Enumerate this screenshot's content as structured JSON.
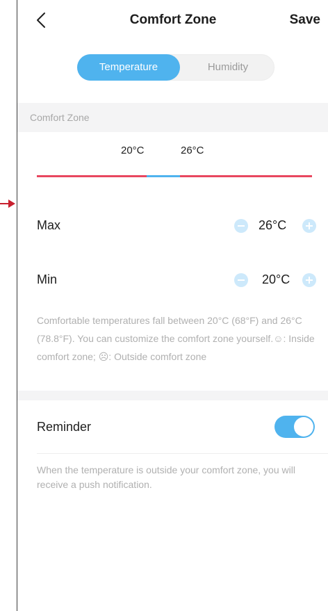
{
  "header": {
    "title": "Comfort Zone",
    "save_label": "Save",
    "back_icon": "chevron-left-icon"
  },
  "tabs": [
    {
      "label": "Temperature",
      "active": true
    },
    {
      "label": "Humidity",
      "active": false
    }
  ],
  "section": {
    "label": "Comfort Zone"
  },
  "range": {
    "min_label": "20°C",
    "max_label": "26°C",
    "outside_color": "#e8475f",
    "inside_color": "#4fb3ee"
  },
  "max_row": {
    "label": "Max",
    "value": "26°C"
  },
  "min_row": {
    "label": "Min",
    "value": "20°C"
  },
  "description": "Comfortable temperatures fall between 20°C (68°F) and 26°C (78.8°F). You can customize the comfort zone yourself.☺: Inside comfort zone; ☹: Outside comfort zone",
  "reminder": {
    "label": "Reminder",
    "enabled": true,
    "description": "When the temperature is outside your comfort zone, you will receive a push notification."
  },
  "colors": {
    "accent": "#4fb3ee",
    "accent_light": "#cde9fb",
    "alert": "#e8475f"
  }
}
